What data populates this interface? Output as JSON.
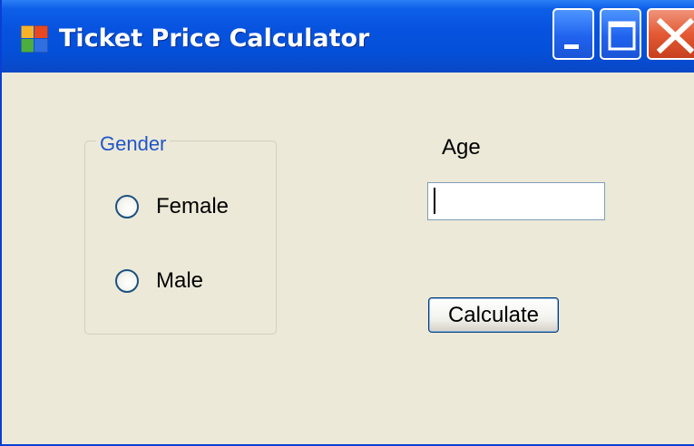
{
  "window": {
    "title": "Ticket Price Calculator",
    "icons": {
      "app": "app-icon",
      "minimize": "minimize-icon",
      "maximize": "maximize-icon",
      "close": "close-icon"
    }
  },
  "gender_group": {
    "label": "Gender",
    "options": [
      {
        "label": "Female",
        "selected": false
      },
      {
        "label": "Male",
        "selected": false
      }
    ]
  },
  "age": {
    "label": "Age",
    "value": "",
    "placeholder": ""
  },
  "calculate_button": {
    "label": "Calculate"
  },
  "colors": {
    "titlebar": "#0753df",
    "window_body": "#ece9d8",
    "group_label": "#2155c9",
    "close_button": "#e35a33"
  }
}
